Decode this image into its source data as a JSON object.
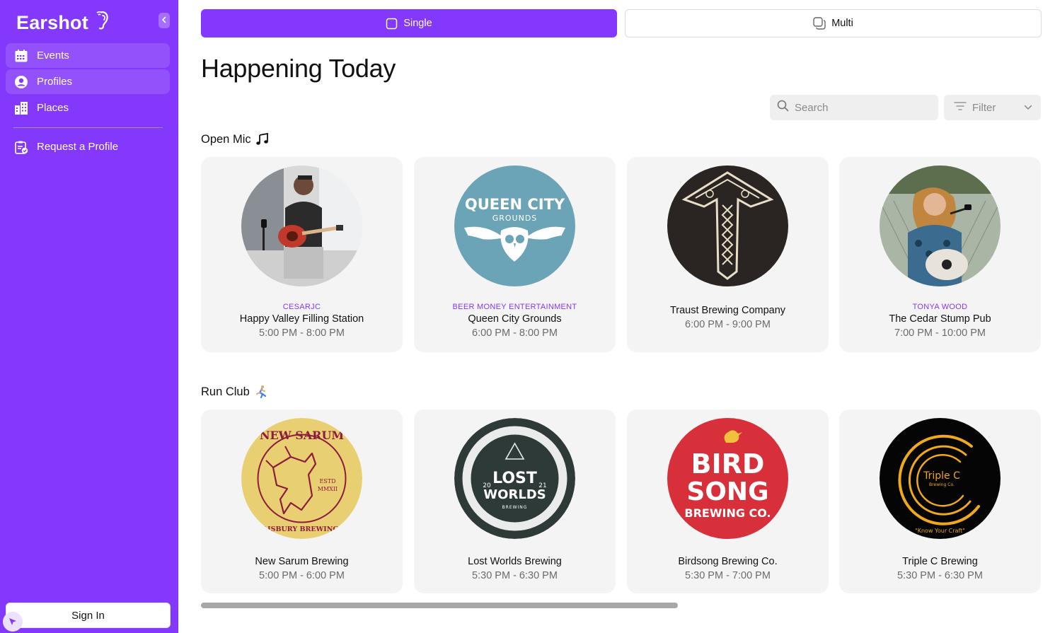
{
  "app": {
    "name": "Earshot"
  },
  "sidebar": {
    "items": [
      {
        "label": "Events",
        "icon": "calendar-icon"
      },
      {
        "label": "Profiles",
        "icon": "user-circle-icon"
      },
      {
        "label": "Places",
        "icon": "buildings-icon"
      }
    ],
    "request_label": "Request a Profile",
    "signin_label": "Sign In"
  },
  "mode_toggle": {
    "single_label": "Single",
    "multi_label": "Multi"
  },
  "page": {
    "title": "Happening Today"
  },
  "search": {
    "placeholder": "Search"
  },
  "filter": {
    "label": "Filter"
  },
  "sections": [
    {
      "title": "Open Mic",
      "emoji_icon": "music-note-icon",
      "cards": [
        {
          "org": "CESARJC",
          "venue": "Happy Valley Filling Station",
          "time": "5:00 PM - 8:00 PM",
          "image": "guitarist-photo"
        },
        {
          "org": "BEER MONEY ENTERTAINMENT",
          "venue": "Queen City Grounds",
          "time": "6:00 PM - 8:00 PM",
          "image": "queen-city-grounds-logo",
          "logo_text": "QUEEN CITY",
          "logo_sub": "GROUNDS"
        },
        {
          "org": "",
          "venue": "Traust Brewing Company",
          "time": "6:00 PM - 9:00 PM",
          "image": "traust-hammer-logo"
        },
        {
          "org": "TONYA WOOD",
          "venue": "The Cedar Stump Pub",
          "time": "7:00 PM - 10:00 PM",
          "image": "singer-photo"
        }
      ]
    },
    {
      "title": "Run Club",
      "emoji_icon": "runner-icon",
      "cards": [
        {
          "org": "",
          "venue": "New Sarum Brewing",
          "time": "5:00 PM - 6:00 PM",
          "image": "new-sarum-logo",
          "logo_text": "NEW SARUM",
          "logo_sub": "SALISBURY BREWING Co",
          "logo_est": "ESTD",
          "logo_year": "MMXII"
        },
        {
          "org": "",
          "venue": "Lost Worlds Brewing",
          "time": "5:30 PM - 6:30 PM",
          "image": "lost-worlds-logo",
          "logo_text": "LOST",
          "logo_sub": "WORLDS",
          "logo_small": "BREWING",
          "logo_num_left": "20",
          "logo_num_right": "21"
        },
        {
          "org": "",
          "venue": "Birdsong Brewing Co.",
          "time": "5:30 PM - 7:00 PM",
          "image": "birdsong-logo",
          "logo_text": "BIRD",
          "logo_sub": "SONG",
          "logo_small": "BREWING CO."
        },
        {
          "org": "",
          "venue": "Triple C Brewing",
          "time": "5:30 PM - 6:30 PM",
          "image": "triple-c-logo",
          "logo_text": "Triple C",
          "logo_small": "Brewing Co.",
          "logo_tag": "\"Know Your Craft\""
        }
      ]
    }
  ],
  "colors": {
    "brand": "#8338fb",
    "card_bg": "#f4f4f4",
    "accent_text": "#8338fb"
  }
}
